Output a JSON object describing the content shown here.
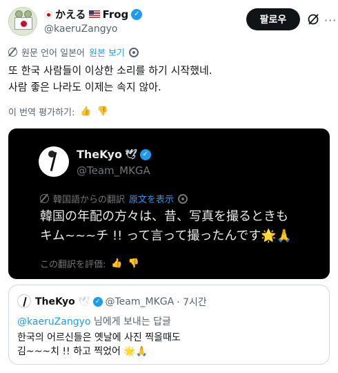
{
  "author": {
    "display_name_prefix": "かえる",
    "display_name_suffix": "Frog",
    "handle": "@kaeruZangyo",
    "verified_mark": "✓"
  },
  "actions": {
    "follow_label": "팔로우",
    "more_label": "···"
  },
  "translation_bar": {
    "text": "원문 언어 일본어",
    "link": "원본 보기"
  },
  "tweet": {
    "line1": "또 한국 사람들이 이상한 소리를 하기 시작했네.",
    "line2": "사람 좋은 나라도 이제는 속지 않아."
  },
  "rate_translation": {
    "label": "이 번역 평가하기:",
    "up": "👍",
    "down": "👎"
  },
  "embedded_card": {
    "name": "TheKyo",
    "dove": "🕊",
    "handle": "@Team_MKGA",
    "translation_label": "韓国語からの翻訳",
    "translation_link": "原文を表示",
    "text_line1": "韓国の年配の方々は、昔、写真を撮るときも",
    "text_line2": "キム~~~チ !! って言って撮ったんです🌟🙏",
    "rate_label": "この翻訳を評価:",
    "up": "👍",
    "down": "👎"
  },
  "quote": {
    "name": "TheKyo",
    "dove": "🕊",
    "handle": "@Team_MKGA",
    "time": "· 7시간",
    "reply_mention": "@kaeruZangyo",
    "reply_suffix": " 님에게 보내는 답글",
    "text_line1": "한국의 어르신들은 옛날에 사진 찍을때도",
    "text_line2": "김~~~치 !! 하고 찍었어 🌟🙏"
  },
  "colors": {
    "accent": "#1d9bf0",
    "text": "#0f1419",
    "muted": "#536471",
    "dark_bg": "#000000"
  },
  "icons": [
    "avatar-frog",
    "japan-flag-icon",
    "us-flag-icon",
    "verified-icon",
    "grok-icon",
    "more-icon",
    "translate-icon",
    "gear-icon",
    "thumbs-up-icon",
    "thumbs-down-icon",
    "dove-icon"
  ]
}
